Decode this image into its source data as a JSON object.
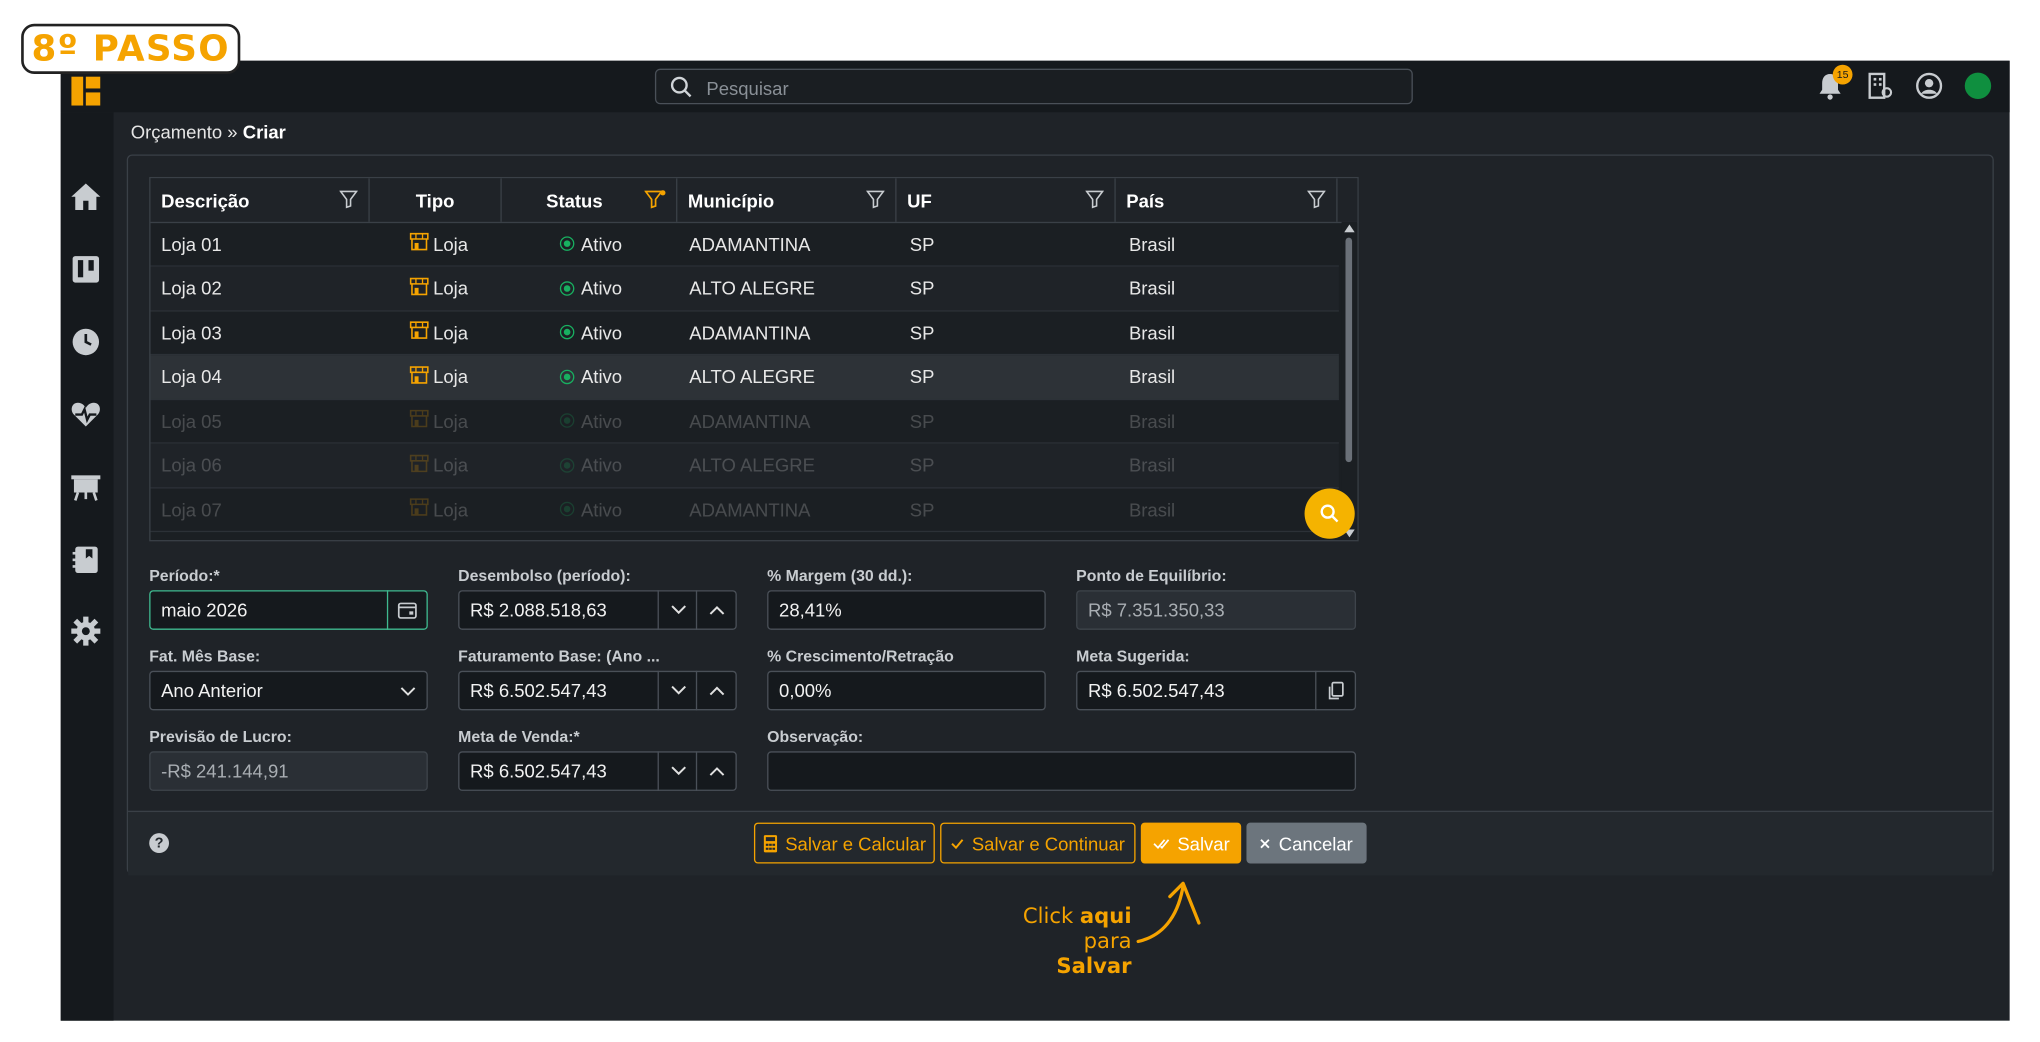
{
  "step_badge": "8º PASSO",
  "search": {
    "placeholder": "Pesquisar"
  },
  "notifications": {
    "count": "15"
  },
  "breadcrumb": {
    "parent": "Orçamento",
    "separator": "»",
    "current": "Criar"
  },
  "grid": {
    "columns": [
      "Descrição",
      "Tipo",
      "Status",
      "Município",
      "UF",
      "País"
    ],
    "rows": [
      {
        "descricao": "Loja 01",
        "tipo": "Loja",
        "status": "Ativo",
        "municipio": "ADAMANTINA",
        "uf": "SP",
        "pais": "Brasil"
      },
      {
        "descricao": "Loja 02",
        "tipo": "Loja",
        "status": "Ativo",
        "municipio": "ALTO ALEGRE",
        "uf": "SP",
        "pais": "Brasil"
      },
      {
        "descricao": "Loja 03",
        "tipo": "Loja",
        "status": "Ativo",
        "municipio": "ADAMANTINA",
        "uf": "SP",
        "pais": "Brasil"
      },
      {
        "descricao": "Loja 04",
        "tipo": "Loja",
        "status": "Ativo",
        "municipio": "ALTO ALEGRE",
        "uf": "SP",
        "pais": "Brasil"
      },
      {
        "descricao": "Loja 05",
        "tipo": "Loja",
        "status": "Ativo",
        "municipio": "ADAMANTINA",
        "uf": "SP",
        "pais": "Brasil"
      },
      {
        "descricao": "Loja 06",
        "tipo": "Loja",
        "status": "Ativo",
        "municipio": "ALTO ALEGRE",
        "uf": "SP",
        "pais": "Brasil"
      },
      {
        "descricao": "Loja 07",
        "tipo": "Loja",
        "status": "Ativo",
        "municipio": "ADAMANTINA",
        "uf": "SP",
        "pais": "Brasil"
      }
    ]
  },
  "form": {
    "periodo": {
      "label": "Período:*",
      "value": "maio 2026"
    },
    "desembolso": {
      "label": "Desembolso (período):",
      "value": "R$ 2.088.518,63"
    },
    "margem": {
      "label": "% Margem (30 dd.):",
      "value": "28,41%"
    },
    "equilibrio": {
      "label": "Ponto de Equilíbrio:",
      "value": "R$ 7.351.350,33"
    },
    "fat_mes_base": {
      "label": "Fat. Mês Base:",
      "value": "Ano Anterior"
    },
    "faturamento_base": {
      "label": "Faturamento Base: (Ano ...",
      "value": "R$ 6.502.547,43"
    },
    "crescimento": {
      "label": "% Crescimento/Retração",
      "value": "0,00%"
    },
    "meta_sugerida": {
      "label": "Meta Sugerida:",
      "value": "R$ 6.502.547,43"
    },
    "previsao_lucro": {
      "label": "Previsão de Lucro:",
      "value": "-R$ 241.144,91"
    },
    "meta_venda": {
      "label": "Meta de Venda:*",
      "value": "R$ 6.502.547,43"
    },
    "observacao": {
      "label": "Observação:",
      "value": ""
    }
  },
  "buttons": {
    "salvar_calcular": "Salvar e Calcular",
    "salvar_continuar": "Salvar e Continuar",
    "salvar": "Salvar",
    "cancelar": "Cancelar"
  },
  "hint": {
    "line1_pre": "Click",
    "line1_bold": "aqui",
    "line2_pre": "para",
    "line2_bold": "Salvar"
  },
  "colors": {
    "accent": "#f5a300",
    "active": "#18b060",
    "background": "#1f2328"
  }
}
